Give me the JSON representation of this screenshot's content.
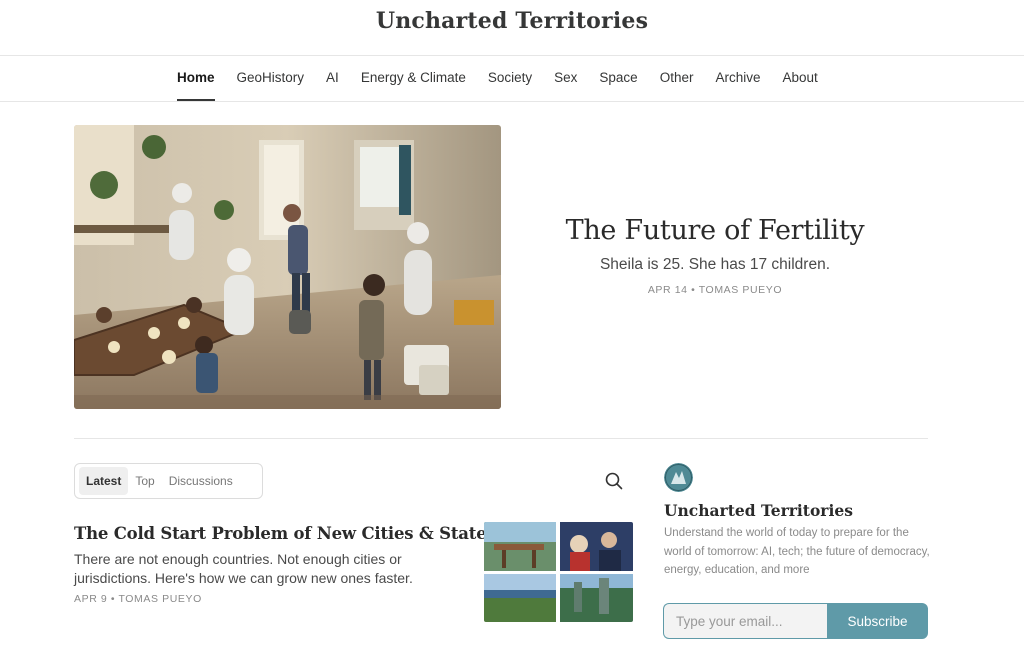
{
  "site": {
    "title": "Uncharted Territories"
  },
  "nav": {
    "items": [
      {
        "label": "Home",
        "active": true
      },
      {
        "label": "GeoHistory"
      },
      {
        "label": "AI"
      },
      {
        "label": "Energy & Climate"
      },
      {
        "label": "Society"
      },
      {
        "label": "Sex"
      },
      {
        "label": "Space"
      },
      {
        "label": "Other"
      },
      {
        "label": "Archive"
      },
      {
        "label": "About"
      }
    ]
  },
  "hero": {
    "title": "The Future of Fertility",
    "subtitle": "Sheila is 25. She has 17 children.",
    "meta": "APR 14 • TOMAS PUEYO"
  },
  "feed": {
    "tabs": [
      {
        "label": "Latest",
        "active": true
      },
      {
        "label": "Top"
      },
      {
        "label": "Discussions"
      }
    ],
    "search_icon": "search-icon",
    "posts": [
      {
        "title": "The Cold Start Problem of New Cities & States",
        "subtitle": "There are not enough countries. Not enough cities or jurisdictions. Here's how we can grow new ones faster.",
        "meta": "APR 9 • TOMAS PUEYO"
      }
    ]
  },
  "sidebar": {
    "name": "Uncharted Territories",
    "description": "Understand the world of today to prepare for the world of tomorrow: AI, tech; the future of democracy, energy, education, and more",
    "subscribe": {
      "placeholder": "Type your email...",
      "button_label": "Subscribe"
    }
  },
  "colors": {
    "accent": "#5f9aa8",
    "text": "#363737",
    "muted": "#8a8a8a",
    "divider": "#e6e6e6"
  }
}
